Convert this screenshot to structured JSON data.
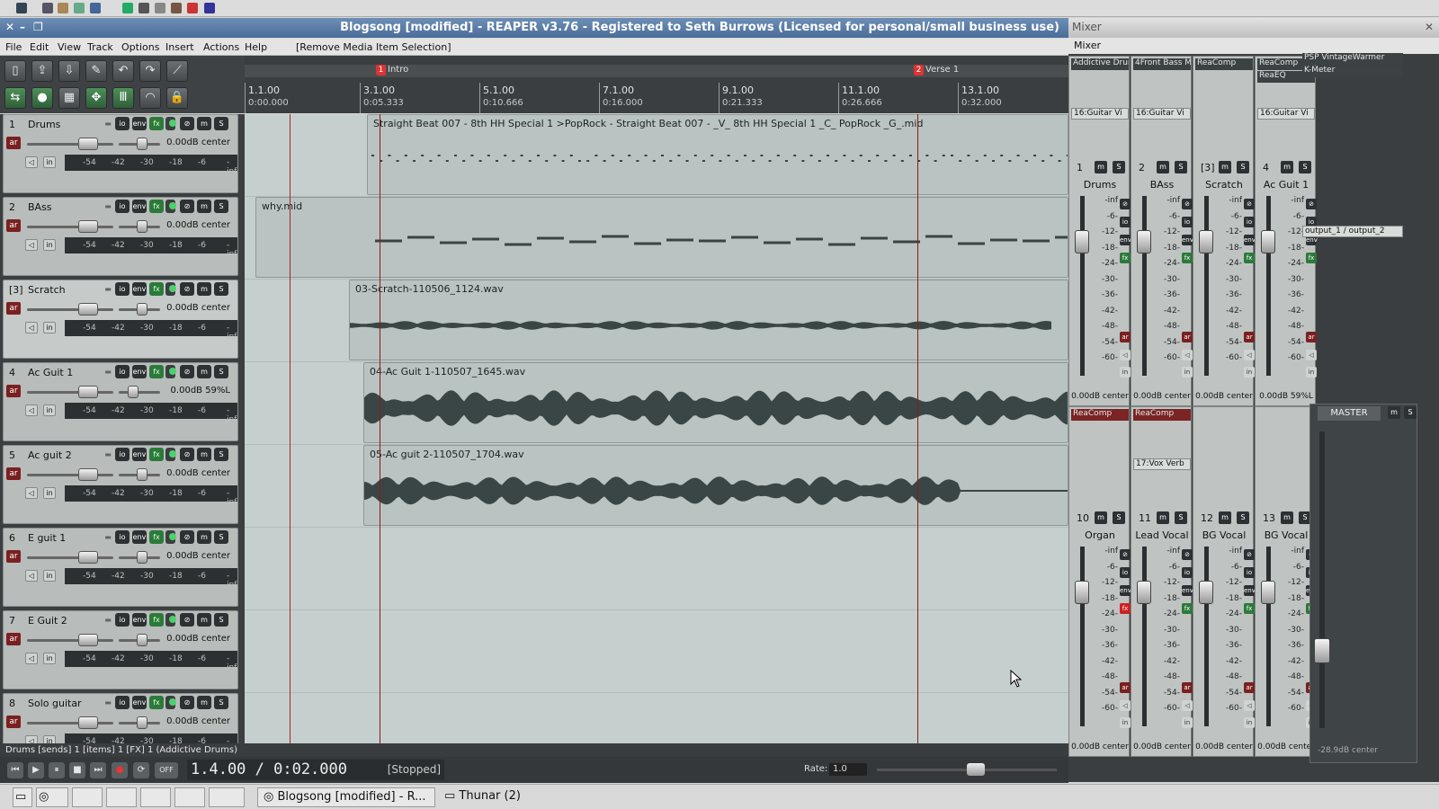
{
  "window": {
    "title": "Blogsong [modified] - REAPER v3.76 - Registered to Seth Burrows (Licensed for personal/small business use)"
  },
  "menu": {
    "items": [
      "File",
      "Edit",
      "View",
      "Track",
      "Options",
      "Insert",
      "Actions",
      "Help"
    ],
    "extra": "[Remove Media Item Selection]"
  },
  "markers": [
    {
      "num": "1",
      "label": "Intro"
    },
    {
      "num": "2",
      "label": "Verse 1"
    }
  ],
  "ruler": {
    "bars": [
      "1.1.00",
      "3.1.00",
      "5.1.00",
      "7.1.00",
      "9.1.00",
      "11.1.00",
      "13.1.00"
    ],
    "times": [
      "0:00.000",
      "0:05.333",
      "0:10.666",
      "0:16.000",
      "0:21.333",
      "0:26.666",
      "0:32.000"
    ]
  },
  "tracks": [
    {
      "num": "1",
      "name": "Drums",
      "vol": "0.00dB center"
    },
    {
      "num": "2",
      "name": "BAss",
      "vol": "0.00dB center"
    },
    {
      "num": "[3]",
      "name": "Scratch",
      "vol": "0.00dB center"
    },
    {
      "num": "4",
      "name": "Ac Guit 1",
      "vol": "0.00dB 59%L"
    },
    {
      "num": "5",
      "name": "Ac guit 2",
      "vol": "0.00dB center"
    },
    {
      "num": "6",
      "name": "E guit 1",
      "vol": "0.00dB center"
    },
    {
      "num": "7",
      "name": "E Guit 2",
      "vol": "0.00dB center"
    },
    {
      "num": "8",
      "name": "Solo guitar",
      "vol": "0.00dB center"
    }
  ],
  "meter_labels": [
    "-54",
    "-42",
    "-30",
    "-18",
    "-6",
    "-inf"
  ],
  "chip_labels": {
    "io": "io",
    "env": "env",
    "fx": "fx",
    "m": "m",
    "s": "S",
    "ar": "ar",
    "in": "in"
  },
  "items": [
    {
      "label": "Straight Beat 007 - 8th HH Special 1 >PopRock - Straight Beat 007 - _V_ 8th HH Special 1 _C_ PopRock _G_.mid"
    },
    {
      "label": "why.mid"
    },
    {
      "label": "03-Scratch-110506_1124.wav"
    },
    {
      "label": "04-Ac Guit 1-110507_1645.wav"
    },
    {
      "label": "05-Ac guit 2-110507_1704.wav"
    }
  ],
  "status": "Drums [sends] 1 [items] 1 [FX] 1 (Addictive Drums)",
  "transport": {
    "time": "1.4.00 / 0:02.000",
    "state": "[Stopped]",
    "rate_label": "Rate:",
    "rate": "1.0",
    "off": "OFF"
  },
  "taskbar": {
    "reaper": "Blogsong [modified] - R...",
    "thunar": "Thunar (2)"
  },
  "mixer": {
    "title": "Mixer",
    "label": "Mixer",
    "strips_top": [
      {
        "num": "1",
        "name": "Drums",
        "fx": [
          "Addictive Drum"
        ],
        "send": "16:Guitar Vi",
        "vol": "0.00dB center"
      },
      {
        "num": "2",
        "name": "BAss",
        "fx": [
          "4Front Bass M"
        ],
        "send": "16:Guitar Vi",
        "vol": "0.00dB center"
      },
      {
        "num": "[3]",
        "name": "Scratch",
        "fx": [
          "ReaComp"
        ],
        "send": "",
        "vol": "0.00dB center"
      },
      {
        "num": "4",
        "name": "Ac Guit 1",
        "fx": [
          "ReaComp",
          "ReaEQ"
        ],
        "send": "16:Guitar Vi",
        "vol": "0.00dB 59%L"
      }
    ],
    "strips_bottom": [
      {
        "num": "10",
        "name": "Organ",
        "fx": [
          "ReaComp"
        ],
        "send": "",
        "vol": "0.00dB center"
      },
      {
        "num": "11",
        "name": "Lead Vocal",
        "fx": [
          "ReaComp"
        ],
        "send": "17:Vox Verb",
        "vol": "0.00dB center"
      },
      {
        "num": "12",
        "name": "BG Vocal",
        "fx": [],
        "send": "",
        "vol": "0.00dB center"
      },
      {
        "num": "13",
        "name": "BG Vocal",
        "fx": [],
        "send": "",
        "vol": "0.00dB center"
      }
    ],
    "scale": [
      "-inf",
      "-6-",
      "-12-",
      "-18-",
      "-24-",
      "-30-",
      "-36-",
      "-42-",
      "-48-",
      "-54-",
      "-60-"
    ],
    "master": {
      "label": "MASTER",
      "fx": [
        "PSP VintageWarmer",
        "K-Meter"
      ],
      "output": "output_1 / output_2",
      "vol": "-28.9dB center"
    }
  }
}
